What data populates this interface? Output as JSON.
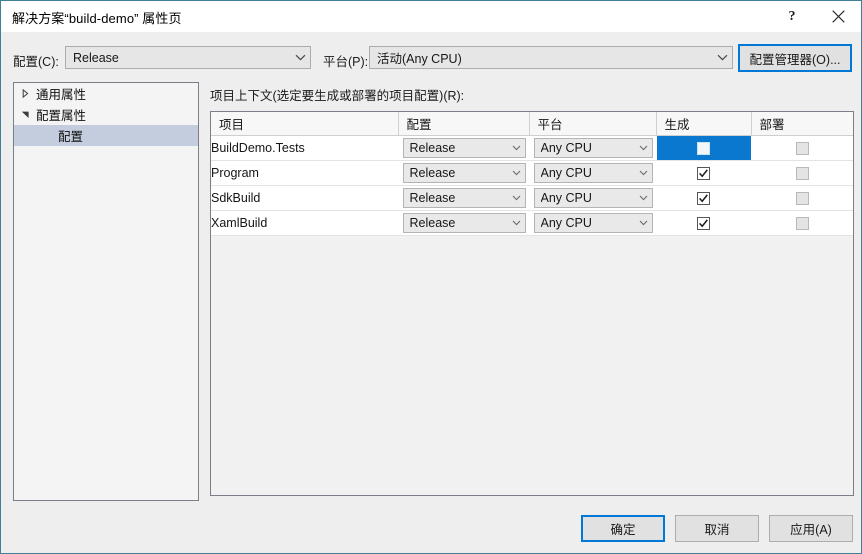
{
  "window": {
    "title": "解决方案“build-demo” 属性页",
    "help_label": "?",
    "close_label": "✕"
  },
  "toolbar": {
    "config_label": "配置(C):",
    "config_value": "Release",
    "platform_label": "平台(P):",
    "platform_value": "活动(Any CPU)",
    "config_manager_label": "配置管理器(O)..."
  },
  "sidebar": {
    "items": [
      {
        "label": "通用属性",
        "expander": "collapsed",
        "level": 0,
        "selected": false
      },
      {
        "label": "配置属性",
        "expander": "expanded",
        "level": 0,
        "selected": false
      },
      {
        "label": "配置",
        "expander": "none",
        "level": 1,
        "selected": true
      }
    ]
  },
  "main": {
    "context_label": "项目上下文(选定要生成或部署的项目配置)(R):",
    "columns": [
      "项目",
      "配置",
      "平台",
      "生成",
      "部署"
    ],
    "rows": [
      {
        "project": "BuildDemo.Tests",
        "configuration": "Release",
        "platform": "Any CPU",
        "build_checked": false,
        "build_selected": true,
        "deploy_checked": false,
        "deploy_disabled": true
      },
      {
        "project": "Program",
        "configuration": "Release",
        "platform": "Any CPU",
        "build_checked": true,
        "build_selected": false,
        "deploy_checked": false,
        "deploy_disabled": true
      },
      {
        "project": "SdkBuild",
        "configuration": "Release",
        "platform": "Any CPU",
        "build_checked": true,
        "build_selected": false,
        "deploy_checked": false,
        "deploy_disabled": true
      },
      {
        "project": "XamlBuild",
        "configuration": "Release",
        "platform": "Any CPU",
        "build_checked": true,
        "build_selected": false,
        "deploy_checked": false,
        "deploy_disabled": true
      }
    ]
  },
  "footer": {
    "ok_label": "确定",
    "cancel_label": "取消",
    "apply_label": "应用(A)"
  },
  "colors": {
    "accent": "#0078d7",
    "selection_blue": "#0b78d0",
    "tree_selection": "#c4cddd",
    "dialog_border": "#3f7f98",
    "body_bg": "#eeeeee"
  }
}
